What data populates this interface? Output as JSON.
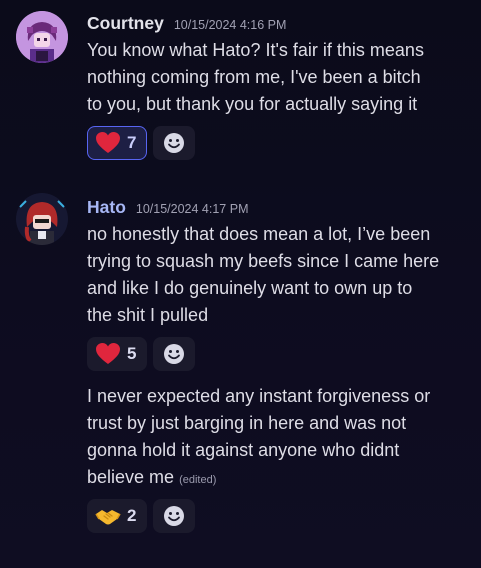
{
  "messages": [
    {
      "username": "Courtney",
      "username_color": "#e3e3ea",
      "timestamp": "10/15/2024 4:16 PM",
      "lines": [
        "You know what Hato? It's fair if this means",
        "nothing coming from me, I've been a bitch",
        "to you, but thank you for actually saying it"
      ],
      "reaction": {
        "emoji": "red-heart-icon",
        "count": "7",
        "active": true
      }
    },
    {
      "username": "Hato",
      "username_color": "#a7b7f5",
      "timestamp": "10/15/2024 4:17 PM",
      "lines": [
        "no honestly that does mean a lot, I’ve been",
        "trying to squash my beefs since I came here",
        "and like I do genuinely want to own up to",
        "the shit I pulled"
      ],
      "reaction": {
        "emoji": "red-heart-icon",
        "count": "5",
        "active": false
      },
      "followup": {
        "lines": [
          "I never expected any instant forgiveness or",
          "trust by just barging in here and was not",
          "gonna hold it against anyone who didnt",
          "believe me"
        ],
        "edited_label": "(edited)",
        "reaction": {
          "emoji": "handshake-icon",
          "count": "2",
          "active": false
        }
      }
    }
  ]
}
